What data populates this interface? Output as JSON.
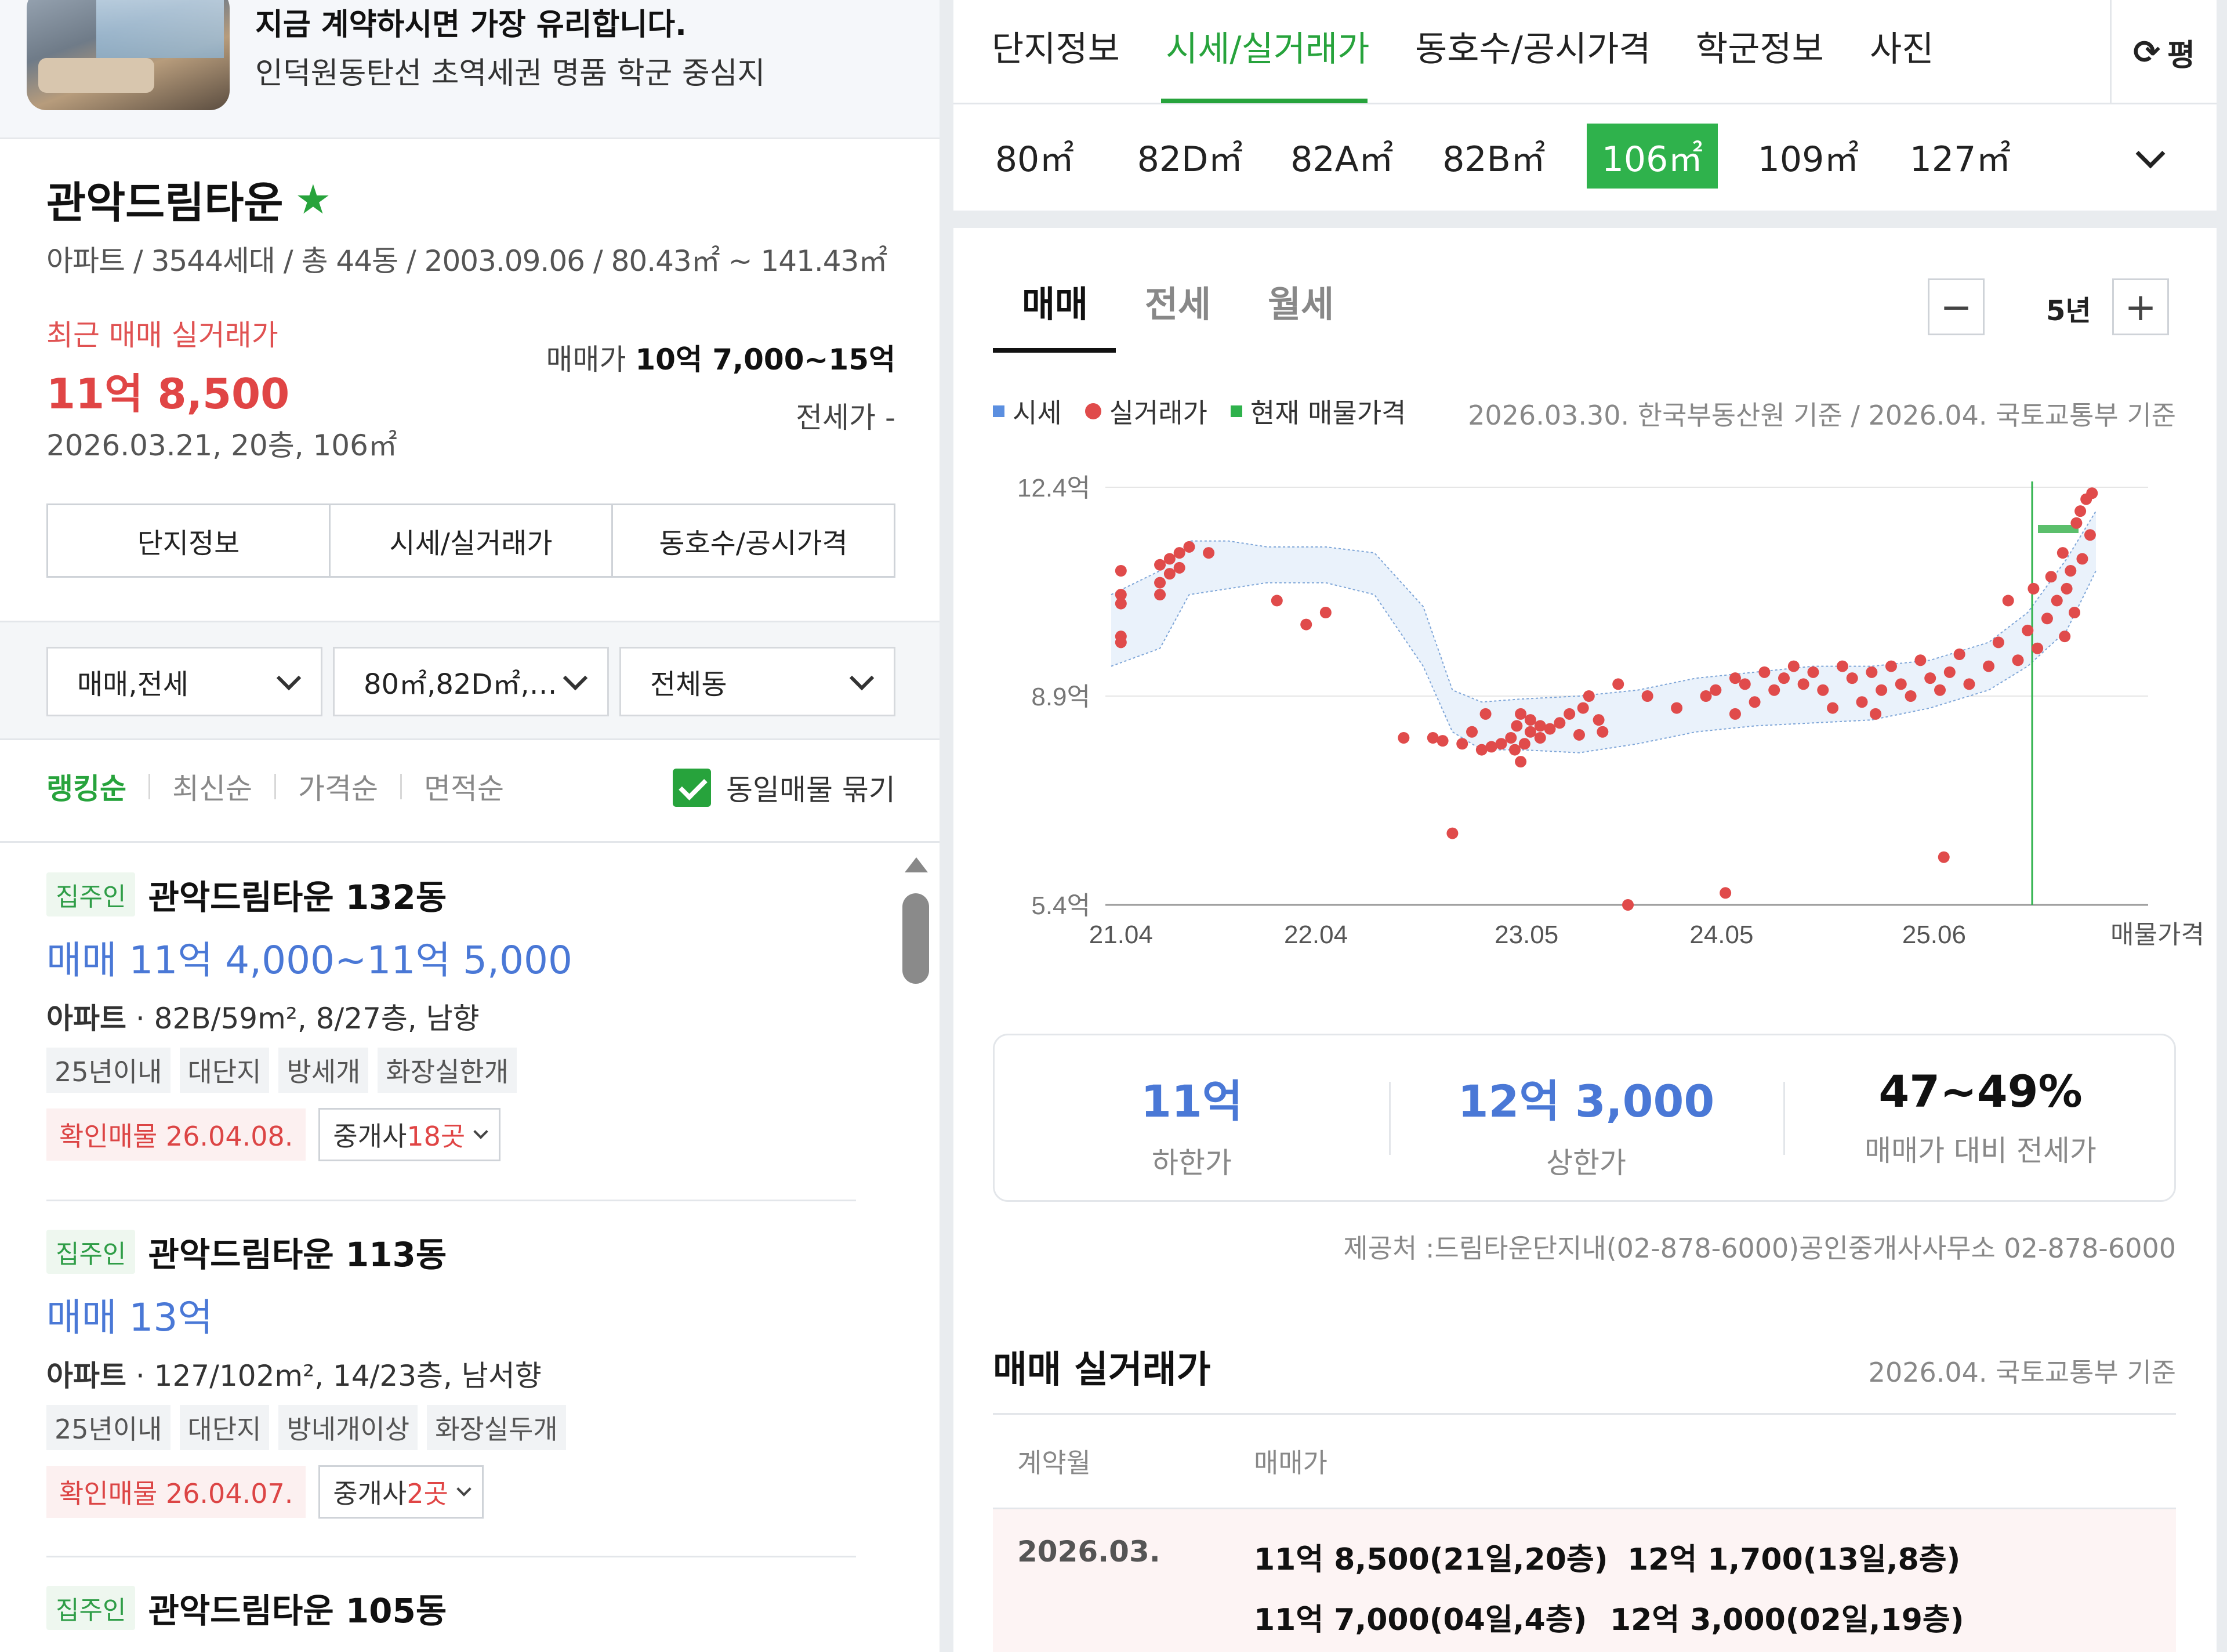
{
  "ad": {
    "title": "지금 계약하시면 가장 유리합니다.",
    "subtitle": "인덕원동탄선 초역세권 명품 학군 중심지"
  },
  "complex": {
    "name": "관악드림타운",
    "info": "아파트 / 3544세대 / 총 44동 / 2003.09.06 / 80.43㎡ ~ 141.43㎡",
    "recent_label": "최근 매매 실거래가",
    "recent_price": "11억 8,500",
    "recent_detail": "2026.03.21, 20층, 106㎡",
    "sale_range_label": "매매가",
    "sale_range_value": "10억 7,000~15억",
    "jeonse": "전세가 -"
  },
  "left_tabs": [
    "단지정보",
    "시세/실거래가",
    "동호수/공시가격"
  ],
  "filters": [
    "매매,전세",
    "80㎡,82D㎡,…",
    "전체동"
  ],
  "sort": {
    "options": [
      "랭킹순",
      "최신순",
      "가격순",
      "면적순"
    ],
    "active": "랭킹순",
    "group_label": "동일매물 묶기"
  },
  "listings": [
    {
      "owner_tag": "집주인",
      "name": "관악드림타운 132동",
      "price": "매매 11억 4,000~11억 5,000",
      "type": "아파트",
      "detail": " · 82B/59m², 8/27층, 남향",
      "tags": [
        "25년이내",
        "대단지",
        "방세개",
        "화장실한개"
      ],
      "verified": "확인매물 26.04.08.",
      "agent_prefix": "중개사 ",
      "agent_count": "18곳"
    },
    {
      "owner_tag": "집주인",
      "name": "관악드림타운 113동",
      "price": "매매 13억",
      "type": "아파트",
      "detail": " · 127/102m², 14/23층, 남서향",
      "tags": [
        "25년이내",
        "대단지",
        "방네개이상",
        "화장실두개"
      ],
      "verified": "확인매물 26.04.07.",
      "agent_prefix": "중개사 ",
      "agent_count": "2곳"
    },
    {
      "owner_tag": "집주인",
      "name": "관악드림타운 105동"
    }
  ],
  "top_tabs": [
    "단지정보",
    "시세/실거래가",
    "동호수/공시가격",
    "학군정보",
    "사진"
  ],
  "top_tab_active": "시세/실거래가",
  "unit_button": "평",
  "areas": [
    "80㎡",
    "82D㎡",
    "82A㎡",
    "82B㎡",
    "106㎡",
    "109㎡",
    "127㎡"
  ],
  "area_active": "106㎡",
  "sub_tabs": [
    "매매",
    "전세",
    "월세"
  ],
  "sub_tab_active": "매매",
  "period": "5년",
  "legend": [
    "시세",
    "실거래가",
    "현재 매물가격"
  ],
  "chart_source": "2026.03.30. 한국부동산원 기준 / 2026.04. 국토교통부 기준",
  "colors": {
    "accent": "#27a33c",
    "deal_dot": "#e04b4b",
    "band": "#eaf2fb",
    "band_edge": "#7fa6d8",
    "price_blue": "#4a78d6"
  },
  "chart_data": {
    "type": "scatter",
    "title": "",
    "xlabel": "",
    "ylabel": "",
    "y_tick_labels": [
      "12.4억",
      "8.9억",
      "5.4억"
    ],
    "y_ticks": [
      12.4,
      8.9,
      5.4
    ],
    "ylim": [
      5.4,
      12.4
    ],
    "x_tick_labels": [
      "21.04",
      "22.04",
      "23.05",
      "24.05",
      "25.06",
      "매물가격"
    ],
    "x_ticks": [
      2021.25,
      2022.25,
      2023.33,
      2024.33,
      2025.42
    ],
    "xlim": [
      2021.2,
      2026.4
    ],
    "market_band": {
      "x": [
        2021.2,
        2021.45,
        2021.6,
        2021.8,
        2022.0,
        2022.3,
        2022.55,
        2022.8,
        2022.95,
        2023.1,
        2023.3,
        2023.6,
        2023.9,
        2024.2,
        2024.5,
        2024.8,
        2025.1,
        2025.4,
        2025.7,
        2025.9,
        2026.1,
        2026.25
      ],
      "upper": [
        10.6,
        11.0,
        11.5,
        11.5,
        11.4,
        11.4,
        11.3,
        10.4,
        9.0,
        8.8,
        8.85,
        8.9,
        9.0,
        9.2,
        9.3,
        9.4,
        9.4,
        9.5,
        9.8,
        10.3,
        11.2,
        12.0
      ],
      "lower": [
        9.4,
        9.7,
        10.6,
        10.7,
        10.8,
        10.8,
        10.6,
        9.4,
        8.3,
        8.0,
        8.0,
        7.95,
        8.1,
        8.3,
        8.4,
        8.45,
        8.5,
        8.7,
        9.0,
        9.4,
        10.0,
        11.0
      ]
    },
    "listing_price": {
      "x": 2026.3,
      "y": 11.7
    },
    "deals": [
      [
        2021.25,
        11.0
      ],
      [
        2021.25,
        10.6
      ],
      [
        2021.25,
        10.45
      ],
      [
        2021.25,
        9.9
      ],
      [
        2021.25,
        9.8
      ],
      [
        2021.45,
        11.1
      ],
      [
        2021.45,
        10.8
      ],
      [
        2021.45,
        10.6
      ],
      [
        2021.5,
        11.2
      ],
      [
        2021.5,
        10.95
      ],
      [
        2021.55,
        11.3
      ],
      [
        2021.55,
        11.05
      ],
      [
        2021.6,
        11.4
      ],
      [
        2021.7,
        11.3
      ],
      [
        2022.05,
        10.5
      ],
      [
        2022.2,
        10.1
      ],
      [
        2022.3,
        10.3
      ],
      [
        2022.7,
        8.2
      ],
      [
        2022.85,
        8.2
      ],
      [
        2022.9,
        8.15
      ],
      [
        2022.95,
        6.6
      ],
      [
        2023.0,
        8.1
      ],
      [
        2023.05,
        8.3
      ],
      [
        2023.1,
        8.0
      ],
      [
        2023.12,
        8.6
      ],
      [
        2023.15,
        8.05
      ],
      [
        2023.2,
        8.1
      ],
      [
        2023.25,
        8.2
      ],
      [
        2023.27,
        8.0
      ],
      [
        2023.28,
        8.4
      ],
      [
        2023.3,
        8.6
      ],
      [
        2023.3,
        7.8
      ],
      [
        2023.32,
        8.1
      ],
      [
        2023.35,
        8.3
      ],
      [
        2023.35,
        8.5
      ],
      [
        2023.4,
        8.4
      ],
      [
        2023.4,
        8.2
      ],
      [
        2023.45,
        8.35
      ],
      [
        2023.5,
        8.45
      ],
      [
        2023.55,
        8.6
      ],
      [
        2023.6,
        8.25
      ],
      [
        2023.62,
        8.7
      ],
      [
        2023.65,
        8.9
      ],
      [
        2023.7,
        8.5
      ],
      [
        2023.72,
        8.3
      ],
      [
        2023.8,
        9.1
      ],
      [
        2023.85,
        5.4
      ],
      [
        2023.95,
        8.9
      ],
      [
        2024.1,
        8.7
      ],
      [
        2024.25,
        8.9
      ],
      [
        2024.3,
        9.0
      ],
      [
        2024.35,
        5.6
      ],
      [
        2024.4,
        8.6
      ],
      [
        2024.4,
        9.2
      ],
      [
        2024.45,
        9.1
      ],
      [
        2024.5,
        8.8
      ],
      [
        2024.55,
        9.3
      ],
      [
        2024.6,
        9.0
      ],
      [
        2024.65,
        9.2
      ],
      [
        2024.7,
        9.4
      ],
      [
        2024.75,
        9.1
      ],
      [
        2024.8,
        9.3
      ],
      [
        2024.85,
        9.0
      ],
      [
        2024.9,
        8.7
      ],
      [
        2024.95,
        9.4
      ],
      [
        2025.0,
        9.2
      ],
      [
        2025.05,
        8.8
      ],
      [
        2025.1,
        9.3
      ],
      [
        2025.12,
        8.6
      ],
      [
        2025.15,
        9.0
      ],
      [
        2025.2,
        9.4
      ],
      [
        2025.25,
        9.1
      ],
      [
        2025.3,
        8.9
      ],
      [
        2025.35,
        9.5
      ],
      [
        2025.4,
        9.2
      ],
      [
        2025.45,
        9.0
      ],
      [
        2025.47,
        6.2
      ],
      [
        2025.5,
        9.3
      ],
      [
        2025.55,
        9.6
      ],
      [
        2025.6,
        9.1
      ],
      [
        2025.7,
        9.4
      ],
      [
        2025.75,
        9.8
      ],
      [
        2025.8,
        10.5
      ],
      [
        2025.85,
        9.5
      ],
      [
        2025.9,
        10.0
      ],
      [
        2025.93,
        10.7
      ],
      [
        2025.95,
        9.7
      ],
      [
        2026.0,
        10.2
      ],
      [
        2026.02,
        10.9
      ],
      [
        2026.05,
        10.5
      ],
      [
        2026.08,
        11.3
      ],
      [
        2026.1,
        10.7
      ],
      [
        2026.12,
        11.0
      ],
      [
        2026.15,
        11.8
      ],
      [
        2026.17,
        12.0
      ],
      [
        2026.2,
        12.2
      ],
      [
        2026.22,
        11.6
      ],
      [
        2026.23,
        12.3
      ],
      [
        2026.18,
        11.2
      ],
      [
        2026.14,
        10.3
      ],
      [
        2026.09,
        9.9
      ]
    ]
  },
  "stats": [
    {
      "value": "11억",
      "label": "하한가",
      "color": "#4a78d6"
    },
    {
      "value": "12억 3,000",
      "label": "상한가",
      "color": "#4a78d6"
    },
    {
      "value": "47~49%",
      "label": "매매가 대비 전세가",
      "color": "#111111"
    }
  ],
  "provider": "제공처 :드림타운단지내(02-878-6000)공인중개사사무소 02-878-6000",
  "trade": {
    "title": "매매 실거래가",
    "basis": "2026.04. 국토교통부 기준",
    "headers": [
      "계약월",
      "매매가"
    ],
    "rows": [
      {
        "month": "2026.03.",
        "entries": [
          "11억 8,500(21일,20층)",
          "12억 1,700(13일,8층)",
          "11억 7,000(04일,4층)",
          "12억 3,000(02일,19층)"
        ]
      }
    ]
  }
}
